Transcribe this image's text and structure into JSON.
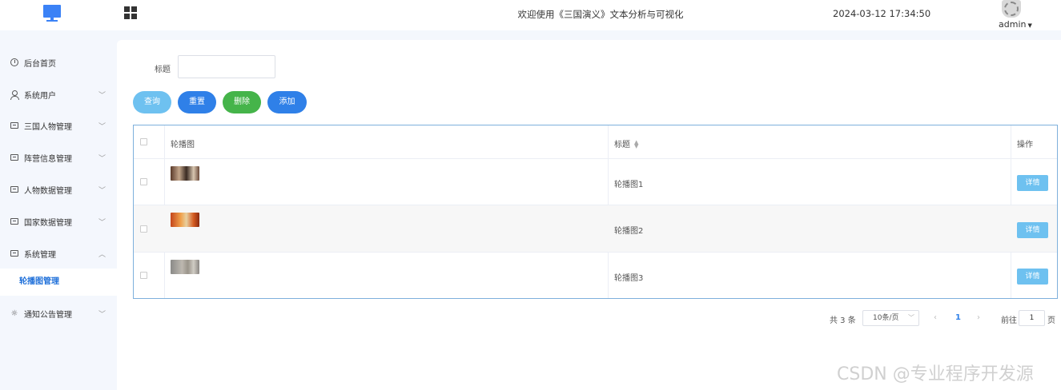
{
  "header": {
    "title": "欢迎使用《三国演义》文本分析与可视化",
    "datetime": "2024-03-12 17:34:50",
    "username": "admin"
  },
  "sidebar": {
    "items": [
      {
        "label": "后台首页",
        "icon": "pie-chart-icon"
      },
      {
        "label": "系统用户",
        "icon": "user-icon"
      },
      {
        "label": "三国人物管理",
        "icon": "card-icon"
      },
      {
        "label": "阵营信息管理",
        "icon": "card-icon"
      },
      {
        "label": "人物数据管理",
        "icon": "card-icon"
      },
      {
        "label": "国家数据管理",
        "icon": "card-icon"
      },
      {
        "label": "系统管理",
        "icon": "checkbox-icon"
      },
      {
        "label": "通知公告管理",
        "icon": "spinner-icon"
      }
    ],
    "sub_item": "轮播图管理"
  },
  "search": {
    "label": "标题",
    "value": ""
  },
  "buttons": {
    "query": "查询",
    "reset": "重置",
    "delete": "删除",
    "add": "添加"
  },
  "table": {
    "headers": {
      "image": "轮播图",
      "title": "标题",
      "action": "操作"
    },
    "rows": [
      {
        "title": "轮播图1",
        "action": "详情"
      },
      {
        "title": "轮播图2",
        "action": "详情"
      },
      {
        "title": "轮播图3",
        "action": "详情"
      }
    ]
  },
  "pagination": {
    "total": "共 3 条",
    "page_size": "10条/页",
    "current": "1",
    "goto_label": "前往",
    "goto_value": "1",
    "page_suffix": "页"
  },
  "watermark": "CSDN @专业程序开发源",
  "colors": {
    "primary": "#2f80e8",
    "info": "#6ec1f0",
    "success": "#45b44a",
    "sidebar_bg": "#f4f7fd"
  }
}
